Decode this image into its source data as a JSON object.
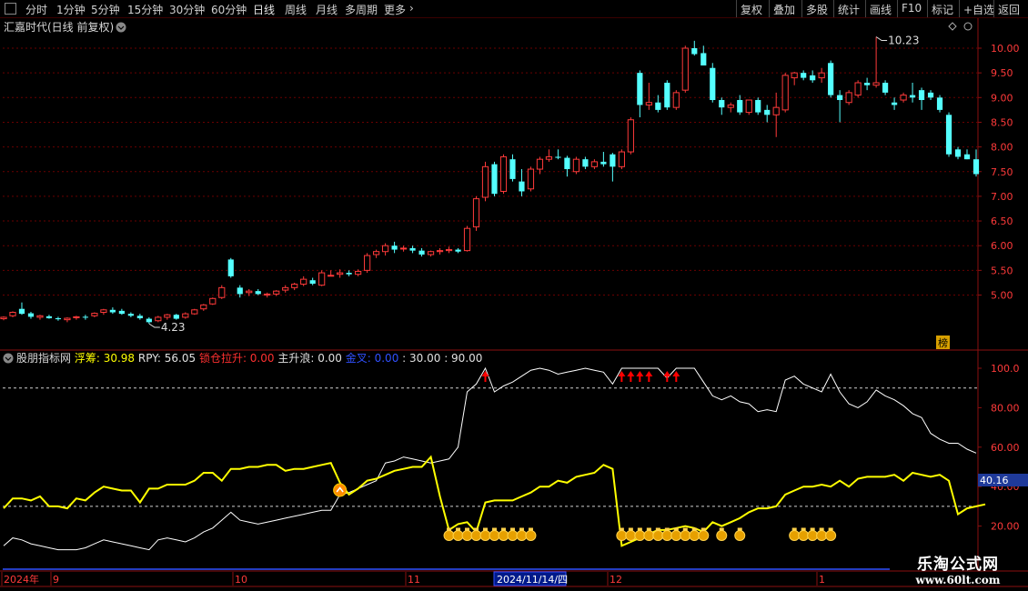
{
  "toolbar": {
    "periods": [
      {
        "label": "分时",
        "active": false
      },
      {
        "label": "1分钟",
        "active": false
      },
      {
        "label": "5分钟",
        "active": false
      },
      {
        "label": "15分钟",
        "active": false
      },
      {
        "label": "30分钟",
        "active": false
      },
      {
        "label": "60分钟",
        "active": false
      },
      {
        "label": "日线",
        "active": true
      },
      {
        "label": "周线",
        "active": false
      },
      {
        "label": "月线",
        "active": false
      },
      {
        "label": "多周期",
        "active": false
      },
      {
        "label": "更多",
        "active": false
      }
    ],
    "more_arrow": "›",
    "right_buttons": [
      "复权",
      "叠加",
      "多股",
      "统计",
      "画线",
      "F10",
      "标记",
      "+自选",
      "返回"
    ]
  },
  "main_chart": {
    "title": "汇嘉时代(日线 前复权)",
    "high_label": "10.23",
    "low_label": "4.23",
    "y_ticks": [
      "10.00",
      "9.50",
      "9.00",
      "8.50",
      "8.00",
      "7.50",
      "7.00",
      "6.50",
      "6.00",
      "5.50",
      "5.00"
    ],
    "badge": "榜"
  },
  "indicator": {
    "name": "股朋指标网",
    "items": [
      {
        "label": "浮筹:",
        "value": "30.98",
        "color": "#ffff00"
      },
      {
        "label": "RPY:",
        "value": "56.05",
        "color": "#e0e0e0"
      },
      {
        "label": "锁仓拉升:",
        "value": "0.00",
        "color": "#ff3030"
      },
      {
        "label": "主升浪:",
        "value": "0.00",
        "color": "#e0e0e0"
      },
      {
        "label": "金叉:",
        "value": "0.00",
        "color": "#3050ff"
      },
      {
        "label": ":",
        "value": "30.00",
        "color": "#e0e0e0"
      },
      {
        "label": ":",
        "value": "90.00",
        "color": "#e0e0e0"
      }
    ],
    "y_ticks": [
      "100.0",
      "80.00",
      "60.00",
      "40.00",
      "20.00"
    ],
    "current_value": "40.16"
  },
  "x_axis": {
    "labels": [
      "2024年",
      "9",
      "10",
      "11",
      "2024/11/14/四",
      "12",
      "1"
    ]
  },
  "watermark": {
    "line1": "乐淘公式网",
    "line2": "www.60lt.com"
  },
  "colors": {
    "up": "#ff3a3a",
    "down": "#54ffff",
    "yellow": "#ffff00",
    "white": "#ffffff",
    "axis": "#8b1010"
  },
  "chart_data": {
    "type": "candlestick",
    "price_candles_ohlc": [
      [
        4.52,
        4.57,
        4.49,
        4.55
      ],
      [
        4.58,
        4.67,
        4.55,
        4.65
      ],
      [
        4.72,
        4.85,
        4.6,
        4.62
      ],
      [
        4.63,
        4.66,
        4.52,
        4.56
      ],
      [
        4.55,
        4.6,
        4.5,
        4.58
      ],
      [
        4.57,
        4.6,
        4.52,
        4.53
      ],
      [
        4.53,
        4.56,
        4.48,
        4.51
      ],
      [
        4.5,
        4.55,
        4.45,
        4.53
      ],
      [
        4.54,
        4.58,
        4.5,
        4.56
      ],
      [
        4.56,
        4.6,
        4.5,
        4.55
      ],
      [
        4.58,
        4.65,
        4.55,
        4.63
      ],
      [
        4.65,
        4.72,
        4.6,
        4.7
      ],
      [
        4.7,
        4.75,
        4.62,
        4.65
      ],
      [
        4.68,
        4.72,
        4.6,
        4.62
      ],
      [
        4.62,
        4.65,
        4.55,
        4.58
      ],
      [
        4.58,
        4.62,
        4.5,
        4.53
      ],
      [
        4.52,
        4.55,
        4.42,
        4.45
      ],
      [
        4.48,
        4.58,
        4.45,
        4.55
      ],
      [
        4.55,
        4.62,
        4.5,
        4.6
      ],
      [
        4.6,
        4.62,
        4.5,
        4.52
      ],
      [
        4.55,
        4.65,
        4.52,
        4.62
      ],
      [
        4.62,
        4.72,
        4.6,
        4.7
      ],
      [
        4.72,
        4.82,
        4.68,
        4.8
      ],
      [
        4.82,
        4.95,
        4.8,
        4.93
      ],
      [
        4.95,
        5.2,
        4.92,
        5.15
      ],
      [
        5.72,
        5.75,
        5.35,
        5.38
      ],
      [
        5.15,
        5.2,
        4.95,
        5.02
      ],
      [
        5.05,
        5.12,
        4.98,
        5.08
      ],
      [
        5.08,
        5.12,
        5.0,
        5.02
      ],
      [
        5.0,
        5.05,
        4.95,
        5.02
      ],
      [
        5.02,
        5.1,
        4.98,
        5.08
      ],
      [
        5.1,
        5.2,
        5.05,
        5.15
      ],
      [
        5.15,
        5.25,
        5.1,
        5.22
      ],
      [
        5.22,
        5.38,
        5.18,
        5.32
      ],
      [
        5.3,
        5.35,
        5.2,
        5.23
      ],
      [
        5.2,
        5.5,
        5.18,
        5.45
      ],
      [
        5.4,
        5.5,
        5.38,
        5.4
      ],
      [
        5.42,
        5.52,
        5.35,
        5.45
      ],
      [
        5.45,
        5.5,
        5.38,
        5.42
      ],
      [
        5.42,
        5.52,
        5.38,
        5.48
      ],
      [
        5.5,
        5.85,
        5.45,
        5.8
      ],
      [
        5.82,
        5.92,
        5.75,
        5.88
      ],
      [
        5.88,
        6.05,
        5.8,
        6.0
      ],
      [
        6.0,
        6.08,
        5.85,
        5.92
      ],
      [
        5.95,
        6.0,
        5.88,
        5.95
      ],
      [
        5.95,
        6.0,
        5.85,
        5.9
      ],
      [
        5.9,
        5.95,
        5.78,
        5.82
      ],
      [
        5.82,
        5.9,
        5.78,
        5.88
      ],
      [
        5.88,
        5.95,
        5.82,
        5.9
      ],
      [
        5.9,
        5.98,
        5.85,
        5.92
      ],
      [
        5.92,
        5.95,
        5.85,
        5.88
      ],
      [
        5.9,
        6.4,
        5.88,
        6.35
      ],
      [
        6.38,
        7.0,
        6.3,
        6.95
      ],
      [
        6.98,
        7.7,
        6.9,
        7.6
      ],
      [
        7.65,
        7.7,
        7.0,
        7.05
      ],
      [
        7.1,
        7.85,
        7.05,
        7.8
      ],
      [
        7.75,
        7.85,
        7.3,
        7.35
      ],
      [
        7.3,
        7.55,
        7.0,
        7.1
      ],
      [
        7.15,
        7.6,
        7.1,
        7.55
      ],
      [
        7.55,
        7.8,
        7.45,
        7.75
      ],
      [
        7.75,
        7.95,
        7.7,
        7.8
      ],
      [
        7.8,
        7.95,
        7.75,
        7.78
      ],
      [
        7.78,
        7.82,
        7.4,
        7.55
      ],
      [
        7.5,
        7.8,
        7.45,
        7.75
      ],
      [
        7.75,
        7.8,
        7.55,
        7.6
      ],
      [
        7.6,
        7.75,
        7.55,
        7.7
      ],
      [
        7.7,
        7.9,
        7.6,
        7.65
      ],
      [
        7.85,
        7.88,
        7.3,
        7.6
      ],
      [
        7.6,
        7.95,
        7.55,
        7.9
      ],
      [
        7.9,
        8.6,
        7.85,
        8.55
      ],
      [
        9.5,
        9.55,
        8.6,
        8.85
      ],
      [
        8.85,
        9.3,
        8.75,
        8.9
      ],
      [
        8.9,
        9.05,
        8.7,
        8.75
      ],
      [
        9.3,
        9.35,
        8.75,
        8.8
      ],
      [
        8.8,
        9.15,
        8.75,
        9.1
      ],
      [
        9.15,
        10.05,
        9.1,
        10.0
      ],
      [
        10.0,
        10.15,
        9.85,
        9.88
      ],
      [
        9.9,
        10.05,
        9.65,
        9.65
      ],
      [
        9.6,
        9.7,
        8.9,
        8.95
      ],
      [
        8.95,
        9.0,
        8.65,
        8.8
      ],
      [
        8.8,
        8.9,
        8.7,
        8.85
      ],
      [
        8.95,
        9.05,
        8.65,
        8.7
      ],
      [
        8.7,
        8.95,
        8.65,
        8.95
      ],
      [
        8.95,
        9.0,
        8.65,
        8.7
      ],
      [
        8.75,
        8.85,
        8.5,
        8.65
      ],
      [
        8.65,
        9.1,
        8.2,
        8.8
      ],
      [
        8.75,
        9.5,
        8.7,
        9.45
      ],
      [
        9.4,
        9.52,
        9.25,
        9.5
      ],
      [
        9.5,
        9.55,
        9.35,
        9.4
      ],
      [
        9.45,
        9.55,
        9.3,
        9.35
      ],
      [
        9.4,
        9.6,
        9.3,
        9.5
      ],
      [
        9.7,
        9.75,
        9.0,
        9.05
      ],
      [
        9.05,
        9.15,
        8.5,
        8.95
      ],
      [
        8.9,
        9.15,
        8.85,
        9.1
      ],
      [
        9.05,
        9.35,
        9.0,
        9.3
      ],
      [
        9.3,
        9.4,
        9.15,
        9.25
      ],
      [
        9.25,
        10.23,
        9.2,
        9.3
      ],
      [
        9.3,
        9.35,
        9.05,
        9.1
      ],
      [
        8.9,
        9.0,
        8.75,
        8.85
      ],
      [
        8.95,
        9.1,
        8.9,
        9.05
      ],
      [
        9.05,
        9.3,
        8.9,
        9.0
      ],
      [
        9.15,
        9.2,
        8.75,
        8.95
      ],
      [
        9.1,
        9.15,
        8.95,
        9.0
      ],
      [
        9.0,
        9.05,
        8.7,
        8.75
      ],
      [
        8.65,
        8.7,
        7.8,
        7.85
      ],
      [
        7.95,
        8.0,
        7.75,
        7.8
      ],
      [
        7.85,
        7.95,
        7.75,
        7.75
      ],
      [
        7.75,
        7.95,
        7.4,
        7.45
      ]
    ],
    "fuchou_yellow": [
      29,
      34,
      34,
      33,
      35,
      30,
      30,
      29,
      34,
      33,
      37,
      40,
      39,
      38,
      38,
      32,
      39,
      39,
      41,
      41,
      41,
      43,
      47,
      47,
      43,
      49,
      49,
      50,
      50,
      51,
      51,
      48,
      49,
      49,
      50,
      51,
      52,
      42,
      36,
      39,
      43,
      44,
      46,
      48,
      49,
      50,
      50,
      55,
      35,
      18,
      21,
      22,
      17,
      32,
      33,
      33,
      33,
      35,
      37,
      40,
      40,
      43,
      42,
      45,
      46,
      47,
      51,
      49,
      10,
      12,
      14,
      16,
      18,
      18,
      19,
      20,
      19,
      17,
      22,
      20,
      22,
      24,
      27,
      29,
      29,
      30,
      36,
      38,
      40,
      40,
      41,
      40,
      43,
      40,
      44,
      45,
      45,
      45,
      46,
      43,
      47,
      46,
      45,
      46,
      43,
      26,
      29,
      30,
      31
    ],
    "rpy_white": [
      10,
      14,
      13,
      11,
      10,
      9,
      8,
      8,
      8,
      9,
      11,
      13,
      12,
      11,
      10,
      9,
      8,
      13,
      14,
      13,
      12,
      14,
      17,
      19,
      23,
      27,
      23,
      22,
      21,
      22,
      23,
      24,
      25,
      26,
      27,
      28,
      28,
      36,
      37,
      39,
      41,
      43,
      52,
      53,
      55,
      54,
      53,
      52,
      53,
      54,
      60,
      88,
      92,
      100,
      88,
      91,
      93,
      96,
      99,
      100,
      99,
      97,
      98,
      99,
      100,
      99,
      98,
      92,
      100,
      100,
      100,
      100,
      100,
      95,
      100,
      100,
      100,
      93,
      86,
      84,
      86,
      83,
      82,
      78,
      79,
      78,
      94,
      96,
      92,
      90,
      88,
      97,
      88,
      82,
      80,
      83,
      89,
      86,
      84,
      81,
      77,
      75,
      67,
      64,
      62,
      62,
      59,
      57
    ],
    "reference_lines": [
      30,
      90
    ]
  }
}
